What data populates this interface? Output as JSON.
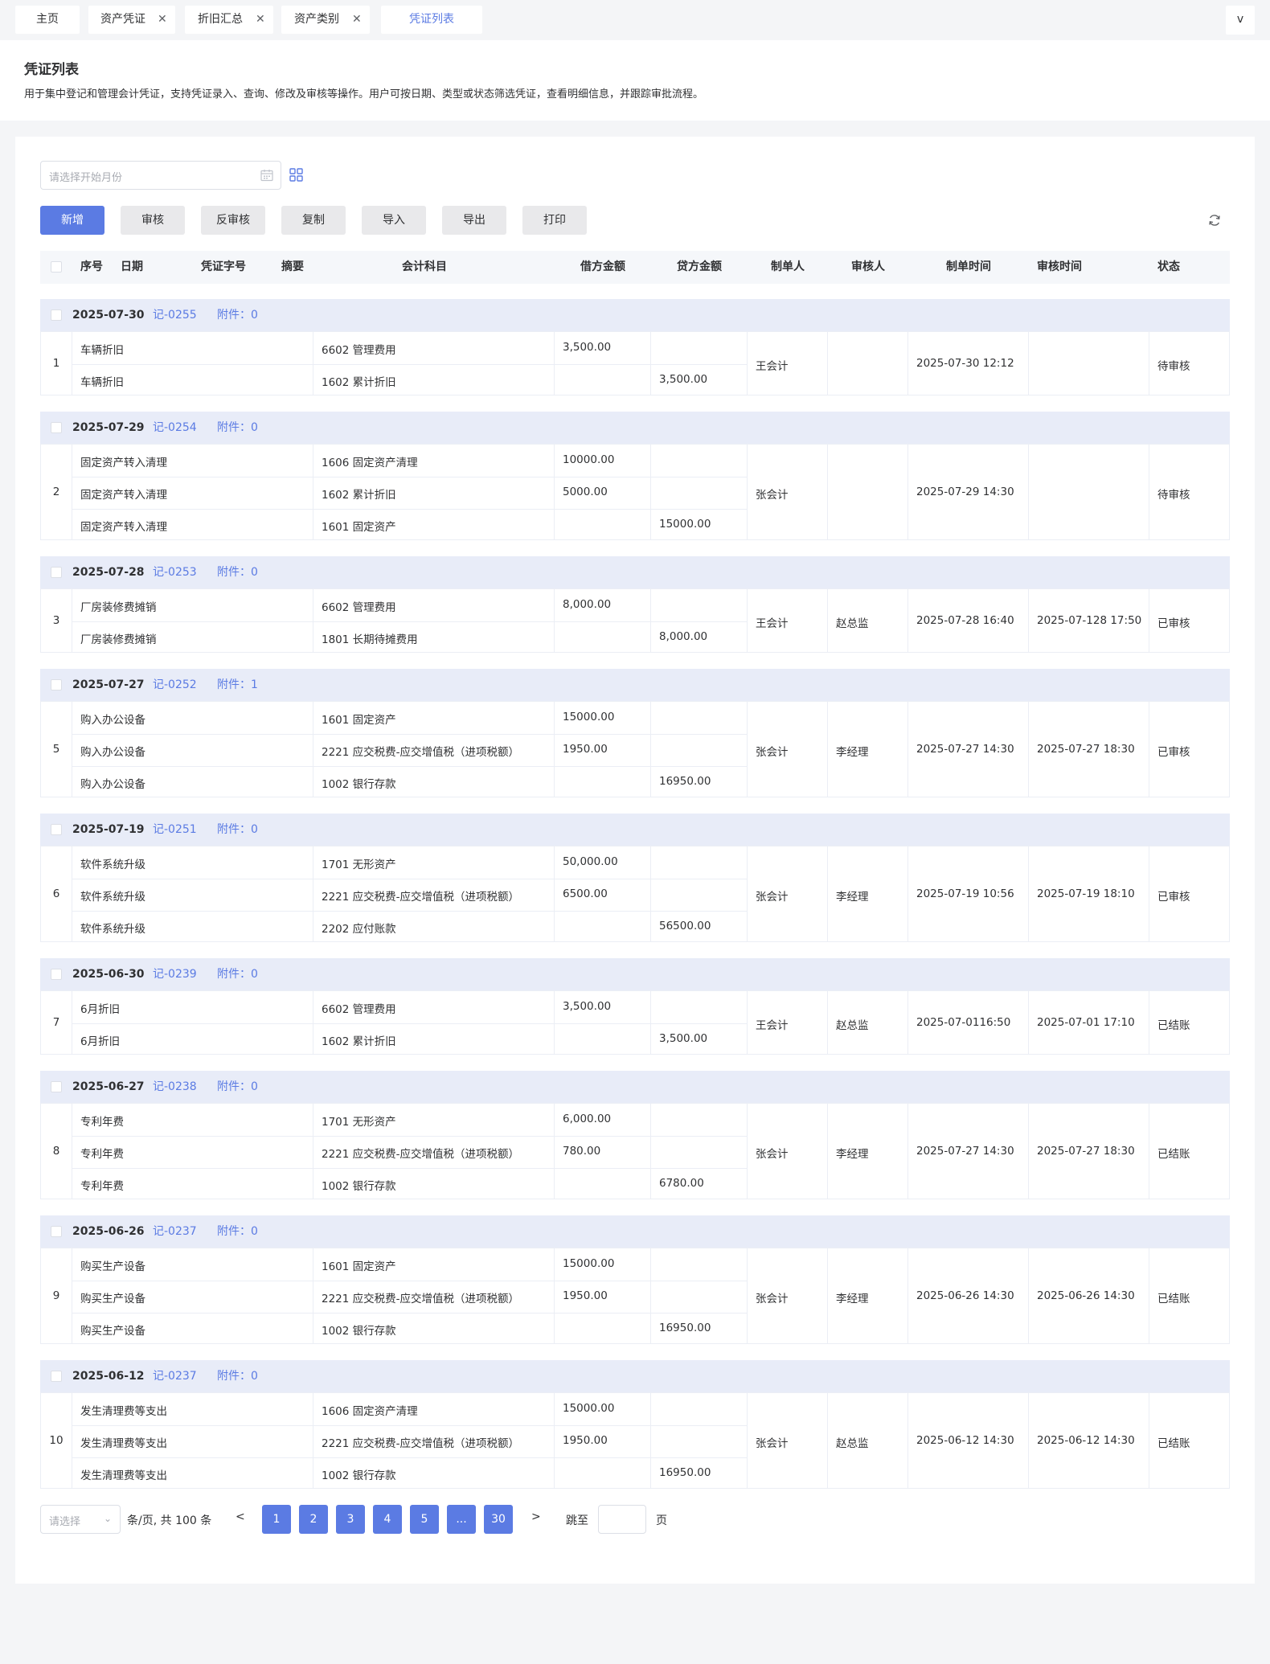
{
  "tabs": [
    {
      "label": "主页",
      "closable": false,
      "active": false
    },
    {
      "label": "资产凭证",
      "closable": true,
      "active": false
    },
    {
      "label": "折旧汇总",
      "closable": true,
      "active": false
    },
    {
      "label": "资产类别",
      "closable": true,
      "active": false
    },
    {
      "label": "凭证列表",
      "closable": false,
      "active": true
    }
  ],
  "tab_menu_label": "v",
  "header": {
    "title": "凭证列表",
    "description": "用于集中登记和管理会计凭证，支持凭证录入、查询、修改及审核等操作。用户可按日期、类型或状态筛选凭证，查看明细信息，并跟踪审批流程。"
  },
  "filter": {
    "month_placeholder": "请选择开始月份"
  },
  "toolbar": {
    "buttons": [
      "新增",
      "审核",
      "反审核",
      "复制",
      "导入",
      "导出",
      "打印"
    ],
    "primary": "新增"
  },
  "table": {
    "columns": {
      "index": "序号",
      "date": "日期",
      "voucher_no": "凭证字号",
      "summary": "摘要",
      "account": "会计科目",
      "debit": "借方金额",
      "credit": "贷方金额",
      "maker": "制单人",
      "auditor": "审核人",
      "make_time": "制单时间",
      "audit_time": "审核时间",
      "status": "状态"
    },
    "attachment_label": "附件：",
    "groups": [
      {
        "index": "1",
        "date": "2025-07-30",
        "voucher_no": "记-0255",
        "attachments": "0",
        "maker": "王会计",
        "auditor": "",
        "make_time": "2025-07-30 12:12",
        "audit_time": "",
        "status": "待审核",
        "lines": [
          {
            "summary": "车辆折旧",
            "account": "6602 管理费用",
            "debit": "3,500.00",
            "credit": ""
          },
          {
            "summary": "车辆折旧",
            "account": "1602 累计折旧",
            "debit": "",
            "credit": "3,500.00"
          }
        ]
      },
      {
        "index": "2",
        "date": "2025-07-29",
        "voucher_no": "记-0254",
        "attachments": "0",
        "maker": "张会计",
        "auditor": "",
        "make_time": "2025-07-29 14:30",
        "audit_time": "",
        "status": "待审核",
        "lines": [
          {
            "summary": "固定资产转入清理",
            "account": "1606 固定资产清理",
            "debit": "10000.00",
            "credit": ""
          },
          {
            "summary": "固定资产转入清理",
            "account": "1602 累计折旧",
            "debit": "5000.00",
            "credit": ""
          },
          {
            "summary": "固定资产转入清理",
            "account": "1601 固定资产",
            "debit": "",
            "credit": "15000.00"
          }
        ]
      },
      {
        "index": "3",
        "date": "2025-07-28",
        "voucher_no": "记-0253",
        "attachments": "0",
        "maker": "王会计",
        "auditor": "赵总监",
        "make_time": "2025-07-28 16:40",
        "audit_time": "2025-07-128 17:50",
        "status": "已审核",
        "lines": [
          {
            "summary": "厂房装修费摊销",
            "account": "6602 管理费用",
            "debit": "8,000.00",
            "credit": ""
          },
          {
            "summary": "厂房装修费摊销",
            "account": "1801 长期待摊费用",
            "debit": "",
            "credit": "8,000.00"
          }
        ]
      },
      {
        "index": "5",
        "date": "2025-07-27",
        "voucher_no": "记-0252",
        "attachments": "1",
        "maker": "张会计",
        "auditor": "李经理",
        "make_time": "2025-07-27 14:30",
        "audit_time": "2025-07-27 18:30",
        "status": "已审核",
        "lines": [
          {
            "summary": "购入办公设备",
            "account": "1601 固定资产",
            "debit": "15000.00",
            "credit": ""
          },
          {
            "summary": "购入办公设备",
            "account": "2221 应交税费-应交增值税（进项税额）",
            "debit": "1950.00",
            "credit": ""
          },
          {
            "summary": "购入办公设备",
            "account": "1002 银行存款",
            "debit": "",
            "credit": "16950.00"
          }
        ]
      },
      {
        "index": "6",
        "date": "2025-07-19",
        "voucher_no": "记-0251",
        "attachments": "0",
        "maker": "张会计",
        "auditor": "李经理",
        "make_time": "2025-07-19 10:56",
        "audit_time": "2025-07-19 18:10",
        "status": "已审核",
        "lines": [
          {
            "summary": "软件系统升级",
            "account": "1701 无形资产",
            "debit": "50,000.00",
            "credit": ""
          },
          {
            "summary": "软件系统升级",
            "account": "2221 应交税费-应交增值税（进项税额）",
            "debit": "6500.00",
            "credit": ""
          },
          {
            "summary": "软件系统升级",
            "account": "2202 应付账款",
            "debit": "",
            "credit": "56500.00"
          }
        ]
      },
      {
        "index": "7",
        "date": "2025-06-30",
        "voucher_no": "记-0239",
        "attachments": "0",
        "maker": "王会计",
        "auditor": "赵总监",
        "make_time": "2025-07-0116:50",
        "audit_time": "2025-07-01 17:10",
        "status": "已结账",
        "lines": [
          {
            "summary": "6月折旧",
            "account": "6602 管理费用",
            "debit": "3,500.00",
            "credit": ""
          },
          {
            "summary": "6月折旧",
            "account": "1602 累计折旧",
            "debit": "",
            "credit": "3,500.00"
          }
        ]
      },
      {
        "index": "8",
        "date": "2025-06-27",
        "voucher_no": "记-0238",
        "attachments": "0",
        "maker": "张会计",
        "auditor": "李经理",
        "make_time": "2025-07-27 14:30",
        "audit_time": "2025-07-27 18:30",
        "status": "已结账",
        "lines": [
          {
            "summary": "专利年费",
            "account": "1701 无形资产",
            "debit": "6,000.00",
            "credit": ""
          },
          {
            "summary": "专利年费",
            "account": "2221 应交税费-应交增值税（进项税额）",
            "debit": "780.00",
            "credit": ""
          },
          {
            "summary": "专利年费",
            "account": "1002 银行存款",
            "debit": "",
            "credit": "6780.00"
          }
        ]
      },
      {
        "index": "9",
        "date": "2025-06-26",
        "voucher_no": "记-0237",
        "attachments": "0",
        "maker": "张会计",
        "auditor": "李经理",
        "make_time": "2025-06-26 14:30",
        "audit_time": "2025-06-26 14:30",
        "status": "已结账",
        "lines": [
          {
            "summary": "购买生产设备",
            "account": "1601 固定资产",
            "debit": "15000.00",
            "credit": ""
          },
          {
            "summary": "购买生产设备",
            "account": "2221 应交税费-应交增值税（进项税额）",
            "debit": "1950.00",
            "credit": ""
          },
          {
            "summary": "购买生产设备",
            "account": "1002 银行存款",
            "debit": "",
            "credit": "16950.00"
          }
        ]
      },
      {
        "index": "10",
        "date": "2025-06-12",
        "voucher_no": "记-0237",
        "attachments": "0",
        "maker": "张会计",
        "auditor": "赵总监",
        "make_time": "2025-06-12 14:30",
        "audit_time": "2025-06-12 14:30",
        "status": "已结账",
        "lines": [
          {
            "summary": "发生清理费等支出",
            "account": "1606 固定资产清理",
            "debit": "15000.00",
            "credit": ""
          },
          {
            "summary": "发生清理费等支出",
            "account": "2221 应交税费-应交增值税（进项税额）",
            "debit": "1950.00",
            "credit": ""
          },
          {
            "summary": "发生清理费等支出",
            "account": "1002 银行存款",
            "debit": "",
            "credit": "16950.00"
          }
        ]
      }
    ]
  },
  "pagination": {
    "page_size_placeholder": "请选择",
    "summary": "条/页, 共 100 条",
    "prev": "<",
    "next": ">",
    "pages": [
      "1",
      "2",
      "3",
      "4",
      "5",
      "...",
      "30"
    ],
    "jump_label": "跳至",
    "page_unit": "页"
  },
  "colors": {
    "primary": "#5b7be3",
    "group_header_bg": "#e8ecf8",
    "table_head_bg": "#f5f7fa",
    "page_bg": "#f4f5f7"
  }
}
